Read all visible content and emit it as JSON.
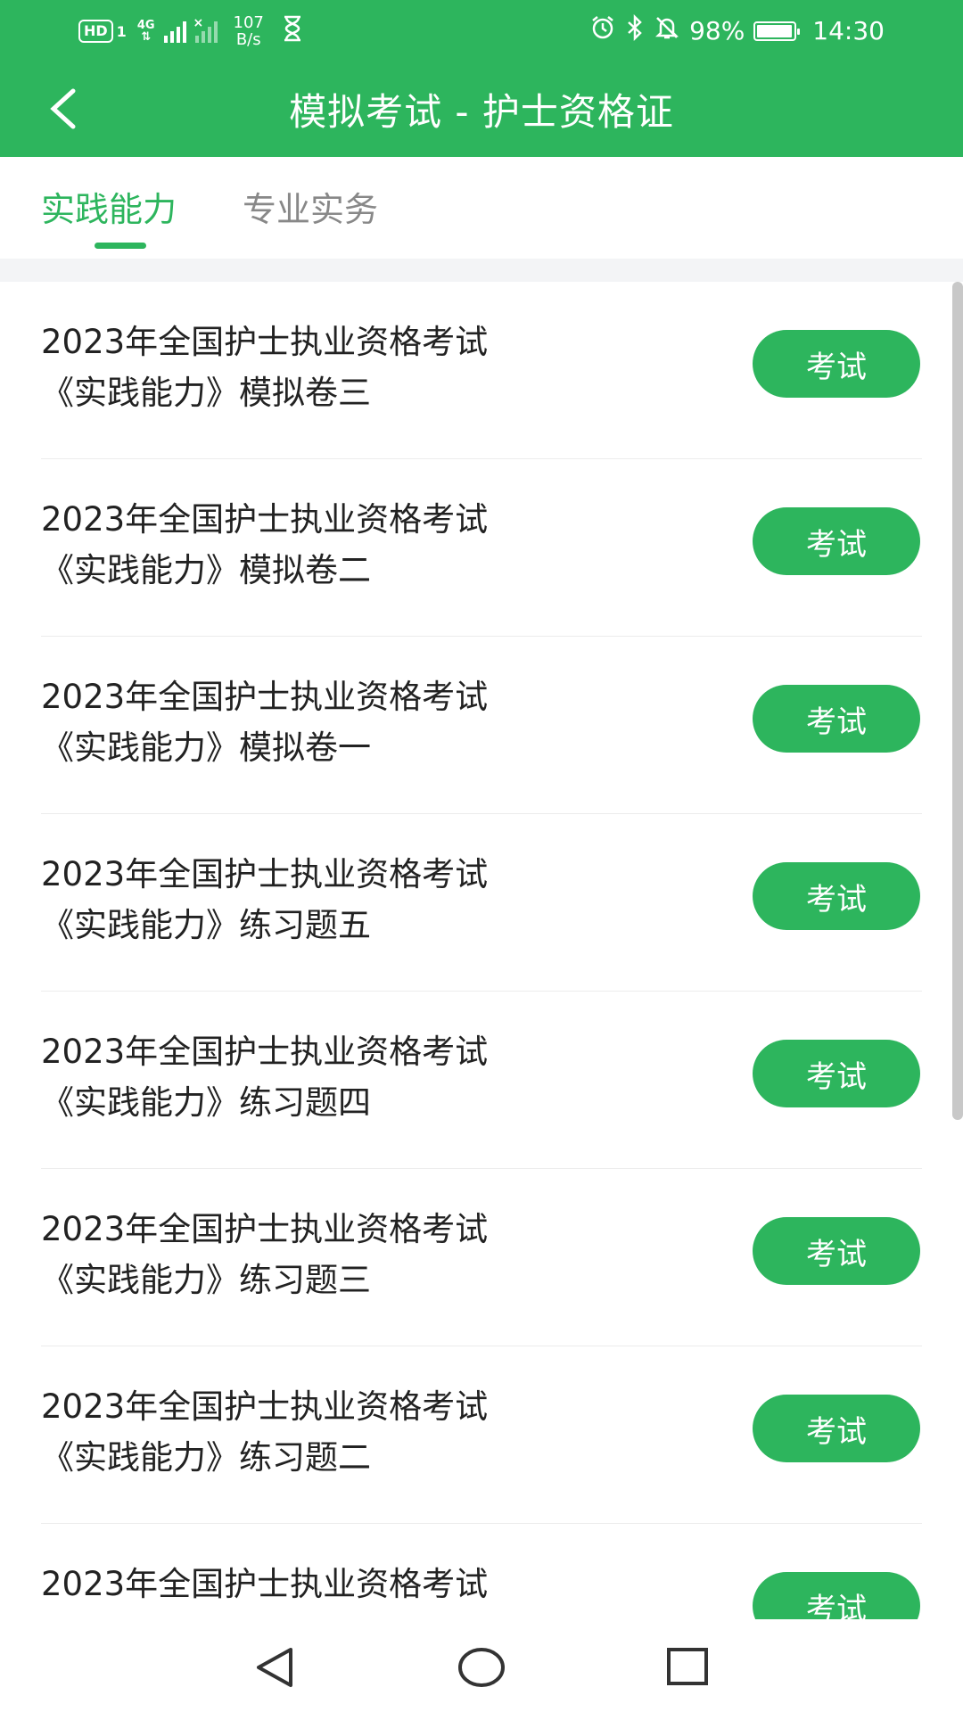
{
  "status_bar": {
    "hd_label": "HD",
    "sim_index": "1",
    "network_type": "4G",
    "net_speed_value": "107",
    "net_speed_unit": "B/s",
    "battery_percent": "98%",
    "battery_level": 0.98,
    "time": "14:30",
    "icons": [
      "signal-icon",
      "no-signal-icon",
      "hourglass-icon",
      "alarm-icon",
      "bluetooth-icon",
      "mute-icon",
      "battery-icon"
    ]
  },
  "header": {
    "title": "模拟考试 - 护士资格证",
    "back_icon": "chevron-left-icon"
  },
  "tabs": [
    {
      "label": "实践能力",
      "active": true
    },
    {
      "label": "专业实务",
      "active": false
    }
  ],
  "exams": [
    {
      "line1": "2023年全国护士执业资格考试",
      "line2": "《实践能力》模拟卷三",
      "button": "考试"
    },
    {
      "line1": "2023年全国护士执业资格考试",
      "line2": "《实践能力》模拟卷二",
      "button": "考试"
    },
    {
      "line1": "2023年全国护士执业资格考试",
      "line2": "《实践能力》模拟卷一",
      "button": "考试"
    },
    {
      "line1": "2023年全国护士执业资格考试",
      "line2": "《实践能力》练习题五",
      "button": "考试"
    },
    {
      "line1": "2023年全国护士执业资格考试",
      "line2": "《实践能力》练习题四",
      "button": "考试"
    },
    {
      "line1": "2023年全国护士执业资格考试",
      "line2": "《实践能力》练习题三",
      "button": "考试"
    },
    {
      "line1": "2023年全国护士执业资格考试",
      "line2": "《实践能力》练习题二",
      "button": "考试"
    },
    {
      "line1": "2023年全国护士执业资格考试",
      "line2": "",
      "button": "考试"
    }
  ],
  "nav_bar": {
    "icons": [
      "nav-back-icon",
      "nav-home-icon",
      "nav-recents-icon"
    ]
  },
  "colors": {
    "accent": "#2db55d",
    "separator": "#ececec",
    "tab_inactive": "#888888"
  }
}
